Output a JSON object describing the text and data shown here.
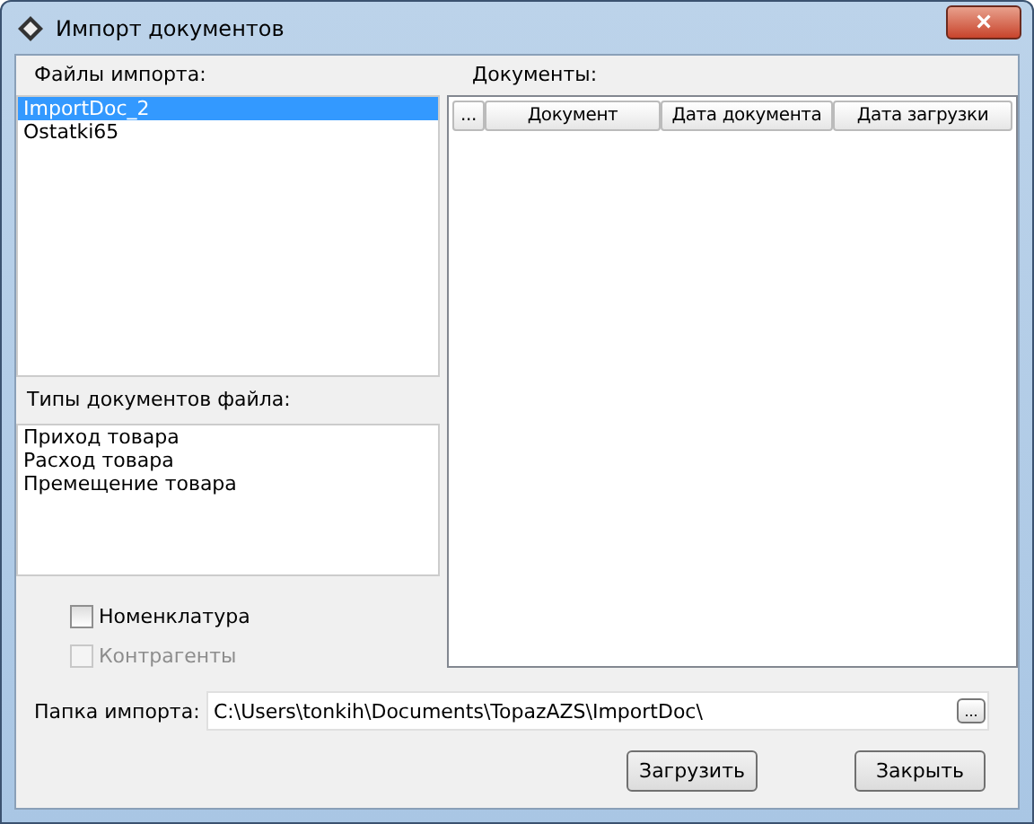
{
  "window": {
    "title": "Импорт документов",
    "close": "×"
  },
  "import_files": {
    "label": "Файлы импорта:",
    "items": [
      {
        "name": "ImportDoc_2",
        "selected": true
      },
      {
        "name": "Ostatki65",
        "selected": false
      }
    ]
  },
  "file_doc_types": {
    "label": "Типы документов файла:",
    "items": [
      "Приход товара",
      "Расход товара",
      "Премещение товара"
    ]
  },
  "options": [
    {
      "label": "Номенклатура",
      "checked": false,
      "disabled": false
    },
    {
      "label": "Контрагенты",
      "checked": false,
      "disabled": true
    }
  ],
  "documents": {
    "label": "Документы:",
    "columns": [
      "...",
      "Документ",
      "Дата документа",
      "Дата загрузки"
    ]
  },
  "import_folder": {
    "label": "Папка импорта:",
    "value": "C:\\Users\\tonkih\\Documents\\TopazAZS\\ImportDoc\\",
    "browse": "..."
  },
  "buttons": [
    "Загрузить",
    "Закрыть"
  ]
}
